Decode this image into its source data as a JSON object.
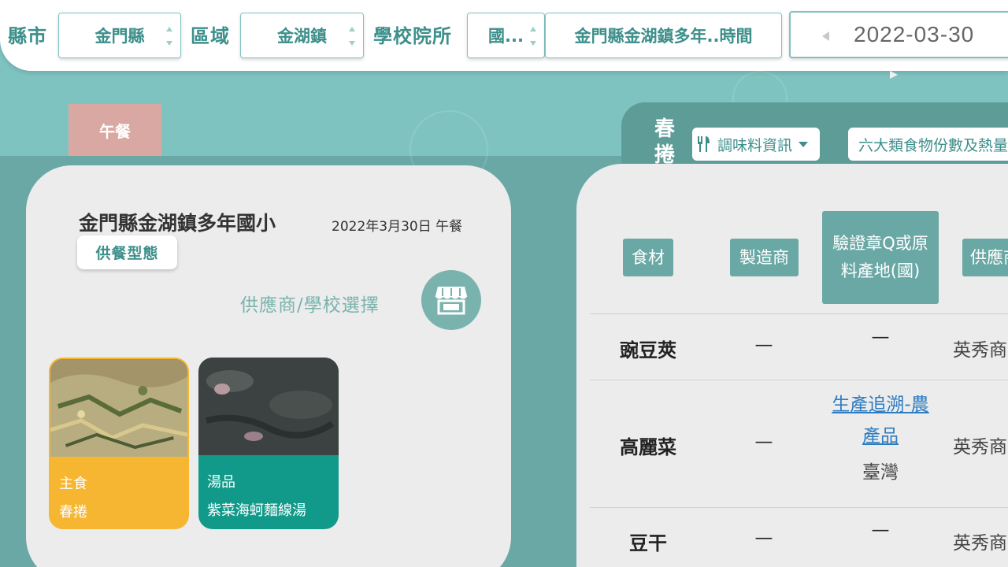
{
  "filters": {
    "county_label": "縣市",
    "county_value": "金門縣",
    "district_label": "區域",
    "district_value": "金湖鎮",
    "school_label": "學校院所",
    "school_type_value": "國...",
    "school_value": "金門縣金湖鎮多年..時間",
    "date_value": "2022-03-30"
  },
  "meal_tab": {
    "label": "午餐"
  },
  "left_card": {
    "school_name": "金門縣金湖鎮多年國小",
    "date_meal": "2022年3月30日 午餐",
    "service_type_button": "供餐型態",
    "supplier_label": "供應商/學校選擇",
    "store_icon": "store-icon",
    "dishes": [
      {
        "category": "主食",
        "name": "春捲",
        "color": "#f7b632"
      },
      {
        "category": "湯品",
        "name": "紫菜海蚵麵線湯",
        "color": "#119a8a"
      }
    ]
  },
  "right_panel": {
    "dish_title": "春捲",
    "buttons": {
      "seasoning": "調味料資訊",
      "six_food": "六大類食物份數及熱量"
    },
    "table": {
      "headers": [
        "食材",
        "製造商",
        "驗證章Q或原料產地(國)",
        "供應商"
      ],
      "rows": [
        {
          "ingredient": "豌豆莢",
          "manufacturer": "—",
          "cert": "—",
          "supplier": "英秀商"
        },
        {
          "ingredient": "高麗菜",
          "manufacturer": "—",
          "cert_link": "生產追溯-農產品",
          "cert_origin": "臺灣",
          "supplier": "英秀商"
        },
        {
          "ingredient": "豆干",
          "manufacturer": "—",
          "cert": "—",
          "supplier": "英秀商"
        }
      ]
    }
  },
  "colors": {
    "teal_dark": "#3c8f8b",
    "teal_bg": "#7fc3c0",
    "teal_header": "#6aa8a5",
    "meal_tab": "#d9a8a2"
  }
}
